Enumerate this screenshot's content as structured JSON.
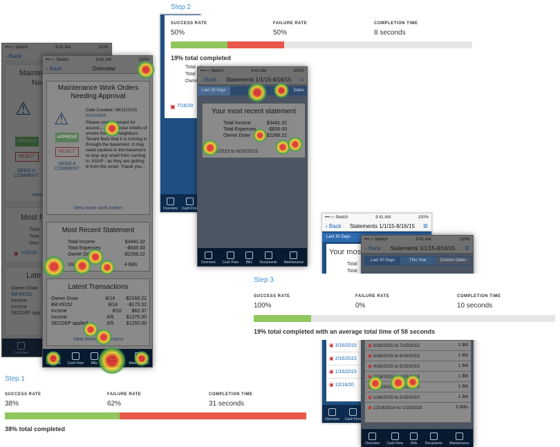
{
  "status": {
    "carrier": "•••○○ Sketch",
    "time": "9:41 AM",
    "battery": "100%"
  },
  "nav": {
    "back": "Back",
    "overview": "Overview",
    "statements_a": "Statements 1/1/15-8/16/15",
    "statements_b": "Statements 1/1/15-8/16/15",
    "statements_c": "Statements 1/1/15-8/16/15"
  },
  "tabs": [
    "Overview",
    "Cash Flow",
    "Bills",
    "Documents",
    "Maintenance"
  ],
  "step1": {
    "label": "Step 1",
    "metrics": {
      "success_label": "SUCCESS RATE",
      "success": "38%",
      "failure_label": "FAILURE RATE",
      "failure": "62%",
      "time_label": "COMPLETION TIME",
      "time": "31 seconds"
    },
    "success_fraction": 0.38,
    "total": "38% total completed",
    "bg": {
      "title": "Maintenance Work Orders Needing Approval",
      "title_short1": "Mainten",
      "title_short2": "Nee",
      "approve": "APPROVE",
      "reject": "REJECT",
      "send": "SEND A COMMENT",
      "view": "View",
      "most": "Most R",
      "total": "Total",
      "owner": "Own",
      "date": "7/16/20",
      "late": "Late",
      "txn_rows": [
        "Owner Draw",
        "Bill #9152",
        "Income",
        "Income",
        "SECDEP app"
      ]
    },
    "overlay": {
      "wo_title": "Maintenance Work Orders Needing Approval",
      "date_created": "Date Created: 08/11/2015",
      "wo_num": "WO#3564",
      "body": "Please contact tenant for access... They cause smells of smoke from the neighbors. Tenant feels that it is coming in through the basement. It may need caulked in the basement to stop any smell from coming in. ASAP - as they are getting ill from the smell. Thank you...",
      "approve": "APPROVE",
      "reject": "REJECT",
      "send": "SEND A COMMENT",
      "view_more": "View more work orders",
      "stmt_title": "Most Recent Statement",
      "stmt_rows": [
        {
          "k": "Total Income",
          "v": "$3441.32"
        },
        {
          "k": "Total Expenses",
          "v": "-$635.00"
        },
        {
          "k": "Owner Draw",
          "v": "-$2268.22"
        }
      ],
      "stmt_range": "16/2015",
      "bills": "4 Bills",
      "txn_title": "Latest Transactions",
      "txns": [
        {
          "k": "Owner Draw",
          "d": "8/14",
          "v": "-$2268.22"
        },
        {
          "k": "Bill #9152",
          "d": "8/14",
          "v": "-$170.32"
        },
        {
          "k": "Income",
          "d": "8/10",
          "v": "$62.37"
        },
        {
          "k": "Income",
          "d": "8/5",
          "v": "$1375.00"
        },
        {
          "k": "SECDEP applied",
          "d": "8/5",
          "v": "$1250.00"
        }
      ],
      "view_tx": "View more transactions"
    }
  },
  "step2": {
    "label": "Step 2",
    "metrics": {
      "success_label": "SUCCESS RATE",
      "success": "50%",
      "failure_label": "FAILURE RATE",
      "failure": "50%",
      "time_label": "COMPLETION TIME",
      "time": "8 seconds"
    },
    "success_fraction": 0.5,
    "total": "19% total completed",
    "bg": {
      "total1": "Total",
      "total2": "Total",
      "owner": "Owner",
      "date": "7/16/20"
    },
    "overlay": {
      "tab_last30": "Last 30 Days",
      "tab_custom": "Dates",
      "recent_title": "Your most recent statement",
      "rows": [
        {
          "k": "Total Income",
          "v": "$3441.32"
        },
        {
          "k": "Total Expenses",
          "v": "-$635.00"
        },
        {
          "k": "Owner Draw",
          "v": "-$2268.22"
        }
      ],
      "range": "6/16/2015 to 6/16/2015"
    }
  },
  "step3": {
    "label": "Step 3",
    "metrics": {
      "success_label": "SUCCESS RATE",
      "success": "100%",
      "failure_label": "FAILURE RATE",
      "failure": "0%",
      "time_label": "COMPLETION TIME",
      "time": "10 seconds"
    },
    "success_fraction": 1.0,
    "total": "19% total completed with an average total time of 58 seconds",
    "bg": {
      "tab_last30": "Last 30 Days",
      "your": "Your most",
      "total1": "Total",
      "total2": "Total",
      "dates": [
        "3/16/2015",
        "2/16/2015",
        "1/16/2015",
        "12/16/20"
      ]
    },
    "overlay": {
      "tabs": [
        "Last 30 Days",
        "This Year",
        "Custom Dates"
      ],
      "rows": [
        {
          "range": "6/16/2015 to 7/15/2015",
          "bills": "1 Bill"
        },
        {
          "range": "5/16/2015 to 6/15/2015",
          "bills": "1 Bill"
        },
        {
          "range": "4/16/2015 to 5/15/2015",
          "bills": "1 Bill"
        },
        {
          "range": "3/16/2015 to 4/15/2015",
          "bills": "1 Bill"
        },
        {
          "range": "2/16/2015 to 3/15/2015",
          "bills": "1 Bill"
        },
        {
          "range": "1/16/2015 to 2/15/2015",
          "bills": "1 Bill"
        },
        {
          "range": "12/16/2014 to 1/15/2015",
          "bills": "5 Bills"
        }
      ]
    }
  }
}
